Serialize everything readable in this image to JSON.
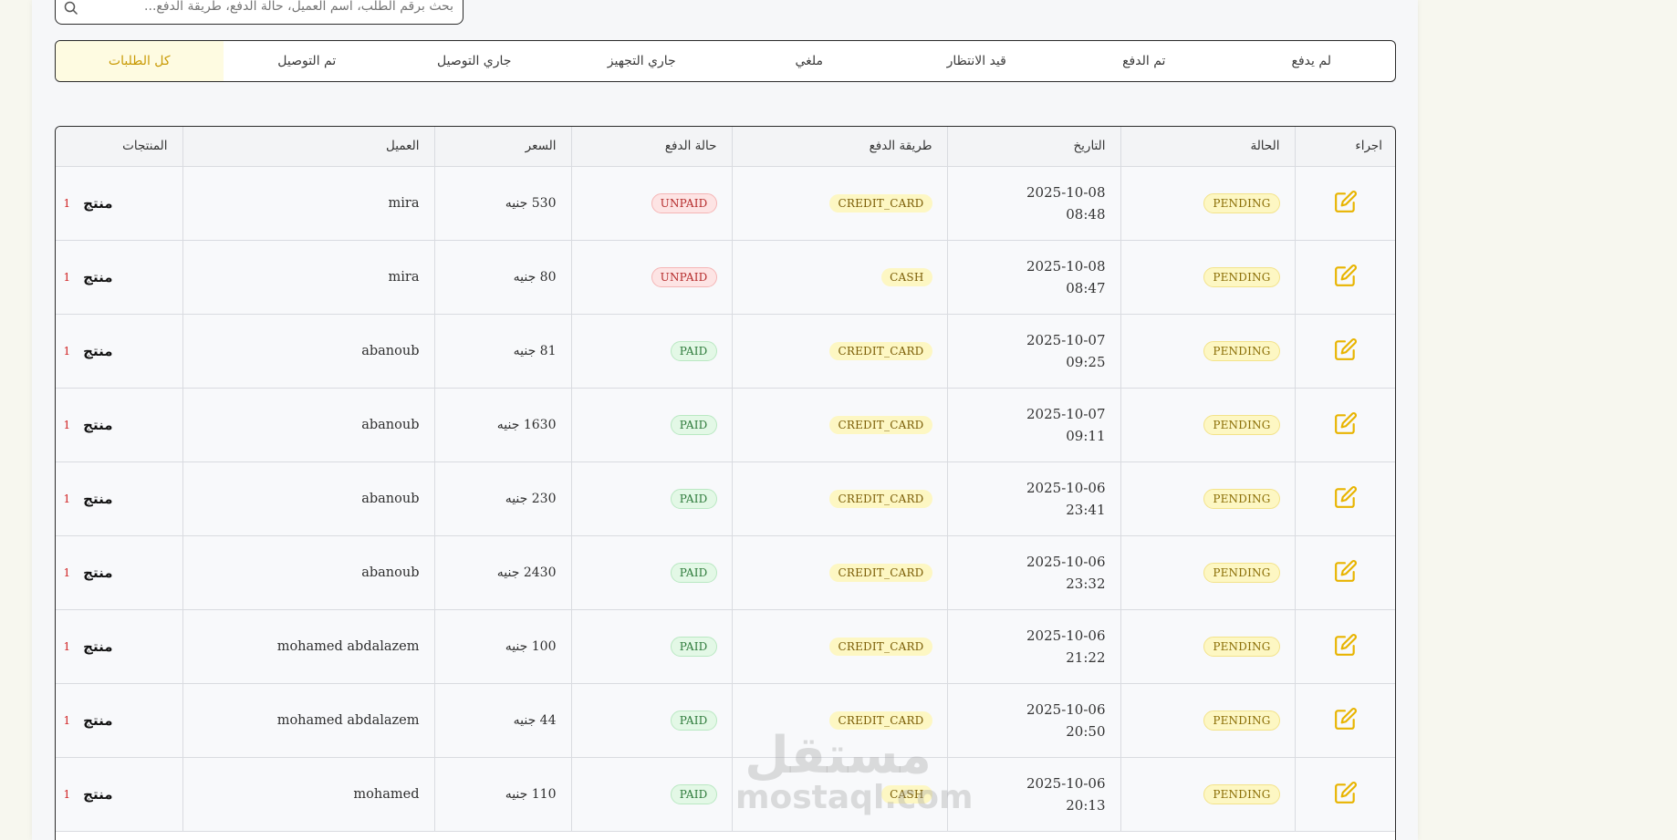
{
  "search": {
    "placeholder": "بحث برقم الطلب، اسم العميل، حالة الدفع، طريقة الدفع..."
  },
  "tabs": [
    {
      "label": "لم يدفع"
    },
    {
      "label": "تم الدفع"
    },
    {
      "label": "قيد الانتظار"
    },
    {
      "label": "ملغي"
    },
    {
      "label": "جاري التجهيز"
    },
    {
      "label": "جاري التوصيل"
    },
    {
      "label": "تم التوصيل"
    },
    {
      "label": "كل الطلبات"
    }
  ],
  "active_tab": "كل الطلبات",
  "columns": {
    "action": "اجراء",
    "status": "الحالة",
    "date": "التاريخ",
    "method": "طريقة الدفع",
    "payment": "حالة الدفع",
    "price": "السعر",
    "customer": "العميل",
    "products": "المنتجات"
  },
  "rows": [
    {
      "status": "PENDING",
      "date": "2025-10-08",
      "time": "08:48",
      "method": "CREDIT_CARD",
      "payment": "UNPAID",
      "price": "530 جنيه",
      "customer": "mira",
      "count": "1",
      "product_label": "منتج"
    },
    {
      "status": "PENDING",
      "date": "2025-10-08",
      "time": "08:47",
      "method": "CASH",
      "payment": "UNPAID",
      "price": "80 جنيه",
      "customer": "mira",
      "count": "1",
      "product_label": "منتج"
    },
    {
      "status": "PENDING",
      "date": "2025-10-07",
      "time": "09:25",
      "method": "CREDIT_CARD",
      "payment": "PAID",
      "price": "81 جنيه",
      "customer": "abanoub",
      "count": "1",
      "product_label": "منتج"
    },
    {
      "status": "PENDING",
      "date": "2025-10-07",
      "time": "09:11",
      "method": "CREDIT_CARD",
      "payment": "PAID",
      "price": "1630 جنيه",
      "customer": "abanoub",
      "count": "1",
      "product_label": "منتج"
    },
    {
      "status": "PENDING",
      "date": "2025-10-06",
      "time": "23:41",
      "method": "CREDIT_CARD",
      "payment": "PAID",
      "price": "230 جنيه",
      "customer": "abanoub",
      "count": "1",
      "product_label": "منتج"
    },
    {
      "status": "PENDING",
      "date": "2025-10-06",
      "time": "23:32",
      "method": "CREDIT_CARD",
      "payment": "PAID",
      "price": "2430 جنيه",
      "customer": "abanoub",
      "count": "1",
      "product_label": "منتج"
    },
    {
      "status": "PENDING",
      "date": "2025-10-06",
      "time": "21:22",
      "method": "CREDIT_CARD",
      "payment": "PAID",
      "price": "100 جنيه",
      "customer": "mohamed abdalazem",
      "count": "1",
      "product_label": "منتج"
    },
    {
      "status": "PENDING",
      "date": "2025-10-06",
      "time": "20:50",
      "method": "CREDIT_CARD",
      "payment": "PAID",
      "price": "44 جنيه",
      "customer": "mohamed abdalazem",
      "count": "1",
      "product_label": "منتج"
    },
    {
      "status": "PENDING",
      "date": "2025-10-06",
      "time": "20:13",
      "method": "CASH",
      "payment": "PAID",
      "price": "110 جنيه",
      "customer": "mohamed",
      "count": "1",
      "product_label": "منتج"
    }
  ],
  "watermark": {
    "arabic": "مستقل",
    "latin": "mostaql.com"
  },
  "colors": {
    "accent": "#e8b400",
    "active_tab_bg": "#fefbe1",
    "pending_bg": "#fdf7c3",
    "paid_bg": "#e3f8e6",
    "unpaid_bg": "#fde4e4"
  },
  "icons": {
    "search": "search-icon",
    "edit": "edit-icon"
  }
}
